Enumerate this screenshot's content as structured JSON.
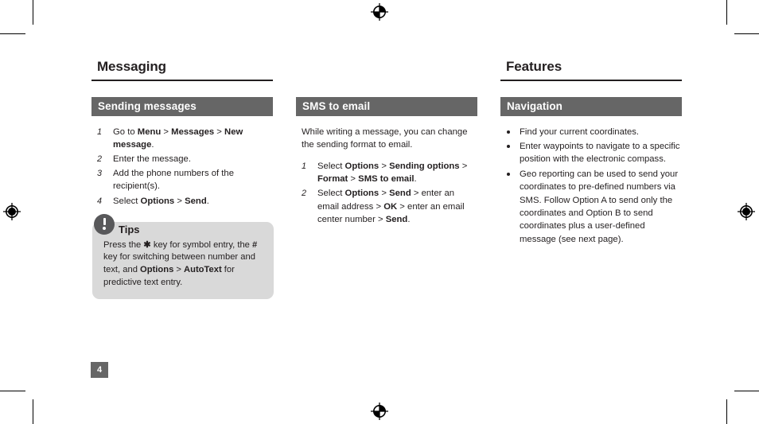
{
  "document": {
    "page_number": "4",
    "colors": {
      "section_bar": "#666666",
      "tips_box": "#d9d9d9",
      "tips_icon": "#58585a",
      "rule": "#231f20",
      "text": "#231f20"
    }
  },
  "left_chapter": {
    "title": "Messaging"
  },
  "right_chapter": {
    "title": "Features"
  },
  "sections": {
    "sending_messages": {
      "heading": "Sending messages",
      "steps": [
        {
          "num": "1",
          "text_html": "Go to <b>Menu</b> > <b>Messages</b> > <b>New message</b>."
        },
        {
          "num": "2",
          "text_html": "Enter the message."
        },
        {
          "num": "3",
          "text_html": "Add the phone numbers of the recipient(s)."
        },
        {
          "num": "4",
          "text_html": "Select <b>Options</b> > <b>Send</b>."
        }
      ]
    },
    "tips": {
      "title": "Tips",
      "icon": "exclamation-icon",
      "body_html": "Press the <b>&#10033;</b> key for symbol entry, the <b>#</b> key for switching between number and text, and <b>Options</b> > <b>AutoText</b> for predictive text entry."
    },
    "sms_to_email": {
      "heading": "SMS to email",
      "intro": "While writing a message, you can change the sending format to email.",
      "steps": [
        {
          "num": "1",
          "text_html": "Select <b>Options</b> > <b>Sending options</b> > <b>Format</b> > <b>SMS to email</b>."
        },
        {
          "num": "2",
          "text_html": "Select <b>Options</b> > <b>Send</b> > enter an email address > <b>OK</b> > enter an email center number > <b>Send</b>."
        }
      ]
    },
    "navigation": {
      "heading": "Navigation",
      "bullets": [
        {
          "text": "Find your current coordinates."
        },
        {
          "text": "Enter waypoints to navigate to a specific position with the  electronic compass."
        },
        {
          "text": "Geo reporting can be used to send your coordinates to pre-defined numbers via SMS. Follow Option A to send only the coordinates and Option B to send coordinates plus a user-defined message (see next page)."
        }
      ]
    }
  }
}
